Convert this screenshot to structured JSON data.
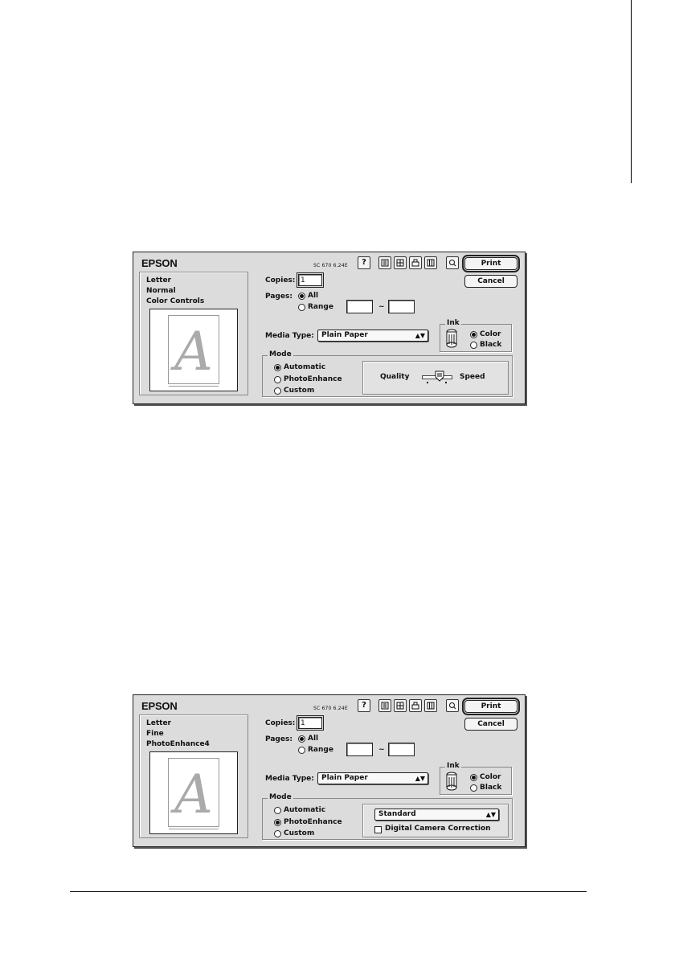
{
  "dialogs": [
    {
      "brand": "EPSON",
      "version": "SC 670 6.24E",
      "help_label": "?",
      "print_label": "Print",
      "cancel_label": "Cancel",
      "summary": [
        "Letter",
        "Normal",
        "Color Controls"
      ],
      "preview_letter": "A",
      "copies_label": "Copies:",
      "copies_value": "1",
      "pages_label": "Pages:",
      "pages_all": "All",
      "pages_range": "Range",
      "range_from": "",
      "range_tilde": "~",
      "range_to": "",
      "pages_selected": "All",
      "media_label": "Media Type:",
      "media_value": "Plain Paper",
      "ink_title": "Ink",
      "ink_color": "Color",
      "ink_black": "Black",
      "ink_selected": "Color",
      "mode_title": "Mode",
      "mode_automatic": "Automatic",
      "mode_photoenhance": "PhotoEnhance",
      "mode_custom": "Custom",
      "mode_selected": "Automatic",
      "quality_label": "Quality",
      "speed_label": "Speed",
      "slider_level": 0.6
    },
    {
      "brand": "EPSON",
      "version": "SC 670 6.24E",
      "help_label": "?",
      "print_label": "Print",
      "cancel_label": "Cancel",
      "summary": [
        "Letter",
        "Fine",
        "PhotoEnhance4"
      ],
      "preview_letter": "A",
      "copies_label": "Copies:",
      "copies_value": "1",
      "pages_label": "Pages:",
      "pages_all": "All",
      "pages_range": "Range",
      "range_from": "",
      "range_tilde": "~",
      "range_to": "",
      "pages_selected": "All",
      "media_label": "Media Type:",
      "media_value": "Plain Paper",
      "ink_title": "Ink",
      "ink_color": "Color",
      "ink_black": "Black",
      "ink_selected": "Color",
      "mode_title": "Mode",
      "mode_automatic": "Automatic",
      "mode_photoenhance": "PhotoEnhance",
      "mode_custom": "Custom",
      "mode_selected": "PhotoEnhance",
      "tone_value": "Standard",
      "digital_camera_label": "Digital Camera Correction",
      "digital_camera_checked": false
    }
  ]
}
